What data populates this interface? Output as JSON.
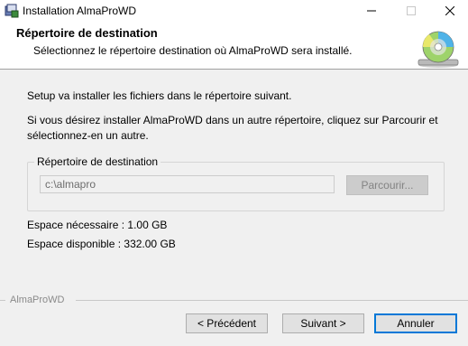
{
  "window": {
    "title": "Installation AlmaProWD",
    "icon": "installer-icon",
    "controls": {
      "minimize": "minimize-icon",
      "maximize": "maximize-icon",
      "close": "close-icon"
    }
  },
  "header": {
    "title": "Répertoire de destination",
    "subtitle": "Sélectionnez le répertoire destination où AlmaProWD sera installé.",
    "icon": "cd-install-icon"
  },
  "body": {
    "intro": "Setup va installer les fichiers dans le répertoire suivant.",
    "instructions": "Si vous désirez installer AlmaProWD dans un autre répertoire, cliquez sur Parcourir et sélectionnez-en un autre."
  },
  "destination": {
    "group_label": "Répertoire de destination",
    "path": "c:\\almapro",
    "browse_label": "Parcourir..."
  },
  "space": {
    "required": "Espace nécessaire : 1.00 GB",
    "available": "Espace disponible : 332.00 GB"
  },
  "footer": {
    "brand": "AlmaProWD",
    "back_label": "< Précédent",
    "next_label": "Suivant >",
    "cancel_label": "Annuler"
  },
  "colors": {
    "accent": "#0078d7",
    "background": "#f0f0f0",
    "header": "#ffffff"
  }
}
